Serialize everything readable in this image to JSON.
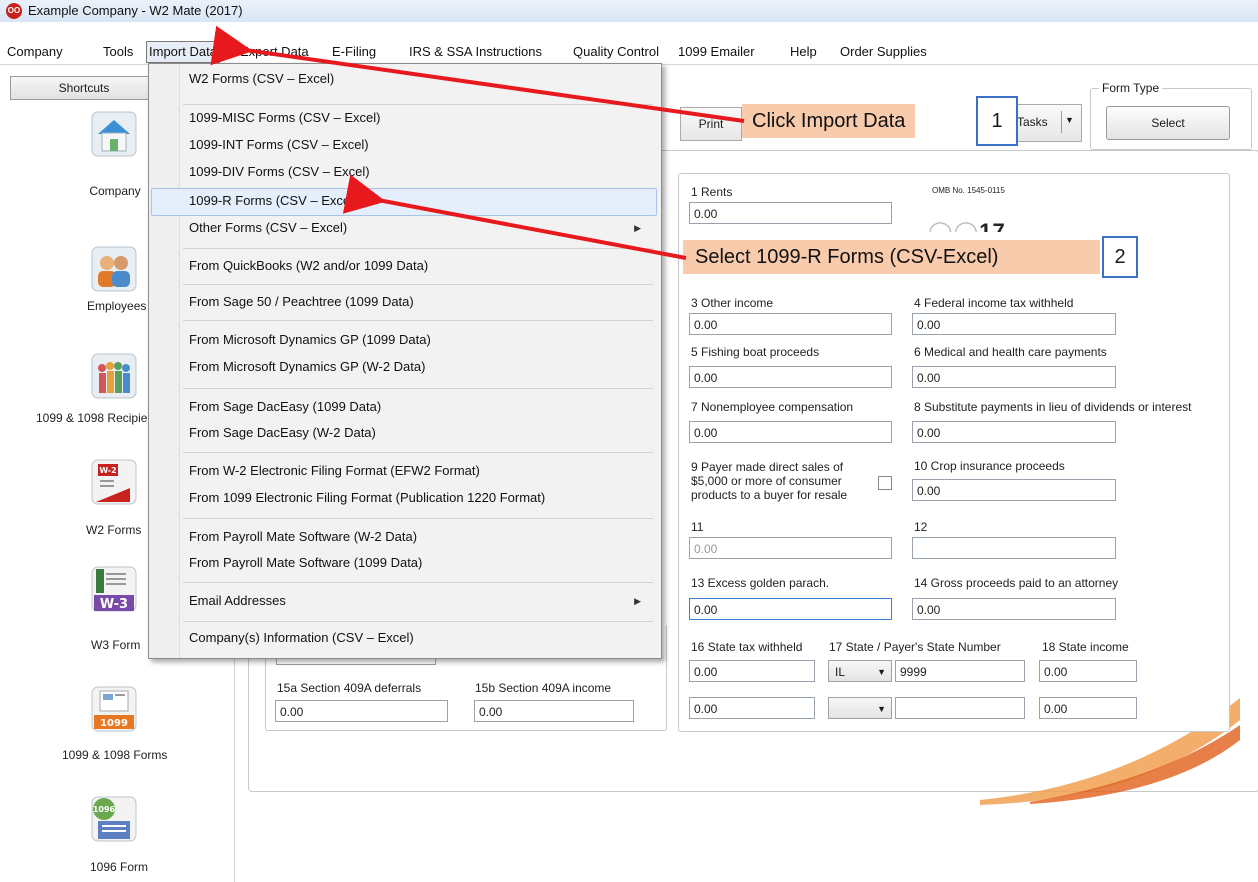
{
  "window": {
    "title": "Example Company - W2 Mate (2017)",
    "logo_text": "OO"
  },
  "menubar": {
    "items": [
      "Company",
      "Tools",
      "Import Data",
      "Export Data",
      "E-Filing",
      "IRS & SSA Instructions",
      "Quality Control",
      "1099 Emailer",
      "Help",
      "Order Supplies"
    ],
    "active": "Import Data"
  },
  "sidebar": {
    "tab": "Shortcuts",
    "items": [
      {
        "label": "Company",
        "icon": "company-house-icon"
      },
      {
        "label": "Employees",
        "icon": "employees-icon"
      },
      {
        "label": "1099 & 1098 Recipients",
        "icon": "recipients-icon"
      },
      {
        "label": "W2 Forms",
        "icon": "w2-form-icon",
        "badge": "W-2"
      },
      {
        "label": "W3 Form",
        "icon": "w3-form-icon",
        "badge": "W-3"
      },
      {
        "label": "1099 & 1098 Forms",
        "icon": "1099-forms-icon",
        "badge": "1099"
      },
      {
        "label": "1096 Form",
        "icon": "1096-form-icon",
        "badge": "1096"
      }
    ]
  },
  "dropdown": {
    "items": [
      "W2 Forms (CSV – Excel)",
      "1099-MISC Forms (CSV – Excel)",
      "1099-INT Forms (CSV – Excel)",
      "1099-DIV Forms (CSV – Excel)",
      "1099-R Forms (CSV – Excel)",
      "Other Forms (CSV – Excel)",
      "From QuickBooks (W2 and/or 1099 Data)",
      "From Sage 50 / Peachtree (1099 Data)",
      "From Microsoft Dynamics GP (1099 Data)",
      "From Microsoft Dynamics GP (W-2 Data)",
      "From Sage DacEasy (1099 Data)",
      "From Sage DacEasy (W-2 Data)",
      "From W-2 Electronic Filing Format (EFW2 Format)",
      "From 1099 Electronic Filing Format (Publication 1220 Format)",
      "From Payroll Mate Software (W-2 Data)",
      "From Payroll Mate Software (1099 Data)",
      "Email Addresses",
      "Company(s) Information (CSV – Excel)"
    ],
    "highlighted": "1099-R Forms (CSV – Excel)"
  },
  "toolbar": {
    "print_label": "Print",
    "tasks_label": "Tasks",
    "form_type_caption": "Form Type",
    "select_label": "Select"
  },
  "callouts": [
    {
      "text": "Click Import Data",
      "number": "1"
    },
    {
      "text": "Select 1099-R Forms (CSV-Excel)",
      "number": "2"
    }
  ],
  "form": {
    "omb": "OMB No. 1545-0115",
    "year": "2017",
    "year_display": "17",
    "box1_label": "1 Rents",
    "box1_value": "0.00",
    "box3_label": "3 Other income",
    "box3_value": "0.00",
    "box4_label": "4 Federal income tax withheld",
    "box4_value": "0.00",
    "box5_label": "5 Fishing boat proceeds",
    "box5_value": "0.00",
    "box6_label": "6 Medical and health care payments",
    "box6_value": "0.00",
    "box7_label": "7 Nonemployee compensation",
    "box7_value": "0.00",
    "box8_label": "8 Substitute payments in lieu of dividends or interest",
    "box8_value": "0.00",
    "box9_label_1": "9 Payer made direct sales of",
    "box9_label_2": "$5,000 or more of consumer",
    "box9_label_3": "products to a buyer for resale",
    "box10_label": "10 Crop insurance proceeds",
    "box10_value": "0.00",
    "box11_label": "11",
    "box11_value": "0.00",
    "box12_label": "12",
    "box12_value": "",
    "box13_label": "13 Excess golden parach.",
    "box13_value": "0.00",
    "box14_label": "14 Gross proceeds paid to an attorney",
    "box14_value": "0.00",
    "box16_label": "16 State tax withheld",
    "box16_value_1": "0.00",
    "box16_value_2": "0.00",
    "box17_label": "17 State / Payer's State Number",
    "box17_state_1": "IL",
    "box17_number_1": "9999",
    "box18_label": "18 State income",
    "box18_value_1": "0.00",
    "box18_value_2": "0.00",
    "box15a_label": "15a Section 409A deferrals",
    "box15a_value": "0.00",
    "box15b_label": "15b Section 409A income",
    "box15b_value": "0.00"
  },
  "colors": {
    "callout_bg": "#f8cbad",
    "callout_border": "#3d6fc4",
    "arrow": "#e8191c",
    "highlight": "#e5eefb"
  }
}
